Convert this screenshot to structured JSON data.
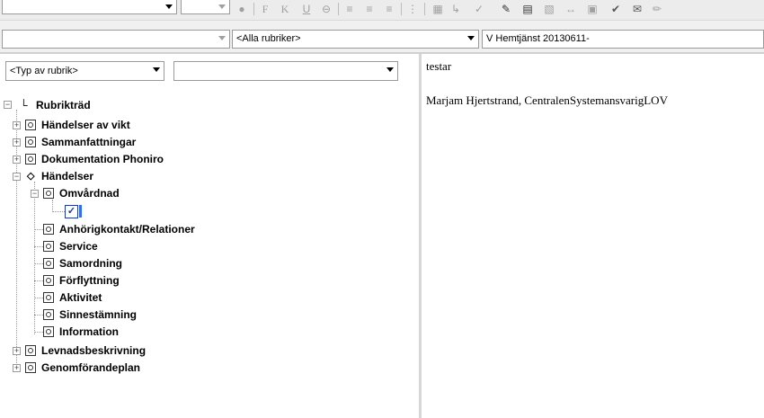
{
  "toolbar": {
    "icons": [
      "bold-icon",
      "italic-icon",
      "underline-icon",
      "strikethrough-icon",
      "align-left-icon",
      "align-center-icon",
      "align-right-icon",
      "list-icon",
      "spellcheck-icon",
      "format-icon",
      "checkmark-icon",
      "signature-icon",
      "document-icon",
      "paste-icon",
      "link-icon",
      "tag-icon",
      "approve-icon",
      "mail-icon",
      "pen-icon"
    ]
  },
  "filters": {
    "category_placeholder": "",
    "category_select": "<Alla rubriker>",
    "journal_select": "V Hemtjänst 20130611-",
    "type_select": "<Typ av rubrik>",
    "type_value_select": ""
  },
  "tree": {
    "root": "Rubrikträd",
    "items": [
      {
        "label": "Händelser av vikt"
      },
      {
        "label": "Sammanfattningar"
      },
      {
        "label": "Dokumentation Phoniro"
      },
      {
        "label": "Händelser"
      },
      {
        "label": "Omvårdnad"
      },
      {
        "label": "Anhörigkontakt/Relationer"
      },
      {
        "label": "Service"
      },
      {
        "label": "Samordning"
      },
      {
        "label": "Förflyttning"
      },
      {
        "label": "Aktivitet"
      },
      {
        "label": "Sinnestämning"
      },
      {
        "label": "Information"
      },
      {
        "label": "Levnadsbeskrivning"
      },
      {
        "label": "Genomförandeplan"
      }
    ]
  },
  "note": {
    "text": "testar",
    "author": "Marjam Hjertstrand, CentralenSystemansvarigLOV"
  }
}
